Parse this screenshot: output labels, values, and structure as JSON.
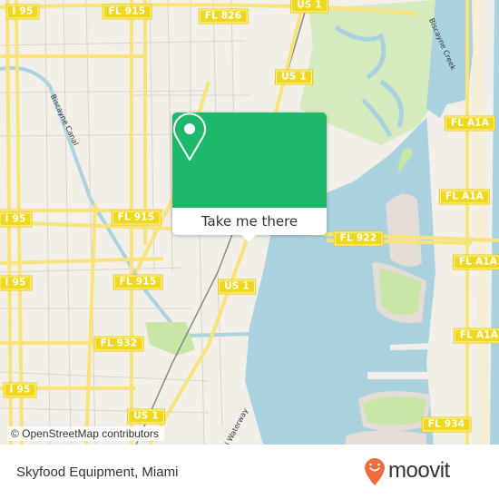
{
  "map": {
    "roads": [
      {
        "label": "I 95"
      },
      {
        "label": "FL 915"
      },
      {
        "label": "FL 826"
      },
      {
        "label": "US 1"
      },
      {
        "label": "US 1"
      },
      {
        "label": "FL A1A"
      },
      {
        "label": "I 95"
      },
      {
        "label": "FL 915"
      },
      {
        "label": "FL 922"
      },
      {
        "label": "FL A1A"
      },
      {
        "label": "I 95"
      },
      {
        "label": "FL 915"
      },
      {
        "label": "US 1"
      },
      {
        "label": "FL A1A"
      },
      {
        "label": "FL 932"
      },
      {
        "label": "I 95"
      },
      {
        "label": "US 1"
      },
      {
        "label": "FL 934"
      }
    ],
    "water_labels": {
      "biscayne_canal": "Biscayne Canal",
      "biscayne_creek": "Biscayne Creek",
      "waterway": "al Waterway"
    },
    "attribution": "© OpenStreetMap contributors",
    "colors": {
      "land": "#f2efe9",
      "water": "#aad3df",
      "park": "#c8e6a5",
      "road": "#f7e37a"
    }
  },
  "popup": {
    "action_label": "Take me there",
    "pin_icon": "map-pin-icon",
    "color": "#1db86a"
  },
  "footer": {
    "place_name": "Skyfood Equipment, Miami",
    "brand": "moovit",
    "brand_color": "#f26c3b"
  }
}
